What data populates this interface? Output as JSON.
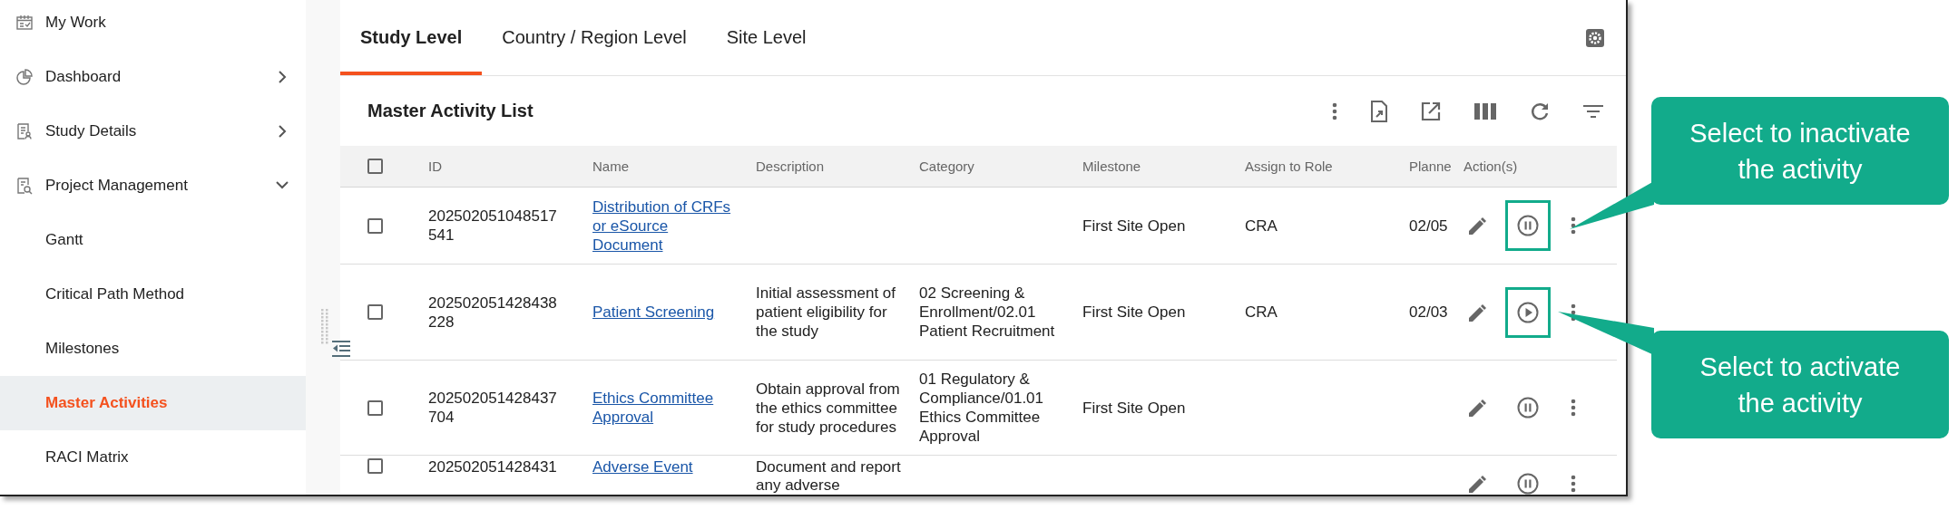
{
  "sidebar": {
    "items": [
      {
        "label": "My Work",
        "kind": "calendar",
        "selected": false
      },
      {
        "label": "Dashboard",
        "kind": "pie",
        "selected": false,
        "expanded": false
      },
      {
        "label": "Study Details",
        "kind": "doc-person",
        "selected": false,
        "expanded": false
      },
      {
        "label": "Project Management",
        "kind": "doc-search",
        "selected": false,
        "expanded": true,
        "children": [
          {
            "label": "Gantt",
            "selected": false
          },
          {
            "label": "Critical Path Method",
            "selected": false
          },
          {
            "label": "Milestones",
            "selected": false
          },
          {
            "label": "Master Activities",
            "selected": true
          },
          {
            "label": "RACI Matrix",
            "selected": false
          }
        ]
      }
    ]
  },
  "tabs": [
    {
      "label": "Study Level",
      "selected": true
    },
    {
      "label": "Country / Region Level",
      "selected": false
    },
    {
      "label": "Site Level",
      "selected": false
    }
  ],
  "list_title": "Master Activity List",
  "table": {
    "select_all_checked": false,
    "columns": [
      "ID",
      "Name",
      "Description",
      "Category",
      "Milestone",
      "Assign to Role",
      "Planne",
      "Action(s)"
    ],
    "rows": [
      {
        "checked": false,
        "id": "202502051048517541",
        "name": "Distribution of CRFs or eSource Document",
        "description": "",
        "category": "",
        "milestone": "First Site Open",
        "role": "CRA",
        "planned": "02/05",
        "active": true,
        "highlighted": true
      },
      {
        "checked": false,
        "id": "202502051428438228",
        "name": "Patient Screening",
        "description": "Initial assessment of patient eligibility for the study",
        "category": "02 Screening & Enrollment/02.01 Patient Recruitment",
        "milestone": "First Site Open",
        "role": "CRA",
        "planned": "02/03",
        "active": false,
        "highlighted": true
      },
      {
        "checked": false,
        "id": "202502051428437704",
        "name": "Ethics Committee Approval",
        "description": "Obtain approval from the ethics committee for study procedures",
        "category": "01 Regulatory & Compliance/01.01 Ethics Committee Approval",
        "milestone": "First Site Open",
        "role": "",
        "planned": "",
        "active": true,
        "highlighted": false
      },
      {
        "checked": false,
        "id": "202502051428431",
        "name": "Adverse Event",
        "description": "Document and report any adverse",
        "category": "",
        "milestone": "",
        "role": "",
        "planned": "",
        "active": true,
        "highlighted": false
      }
    ]
  },
  "callouts": [
    {
      "text": "Select to inactivate the activity"
    },
    {
      "text": "Select to activate the activity"
    }
  ]
}
